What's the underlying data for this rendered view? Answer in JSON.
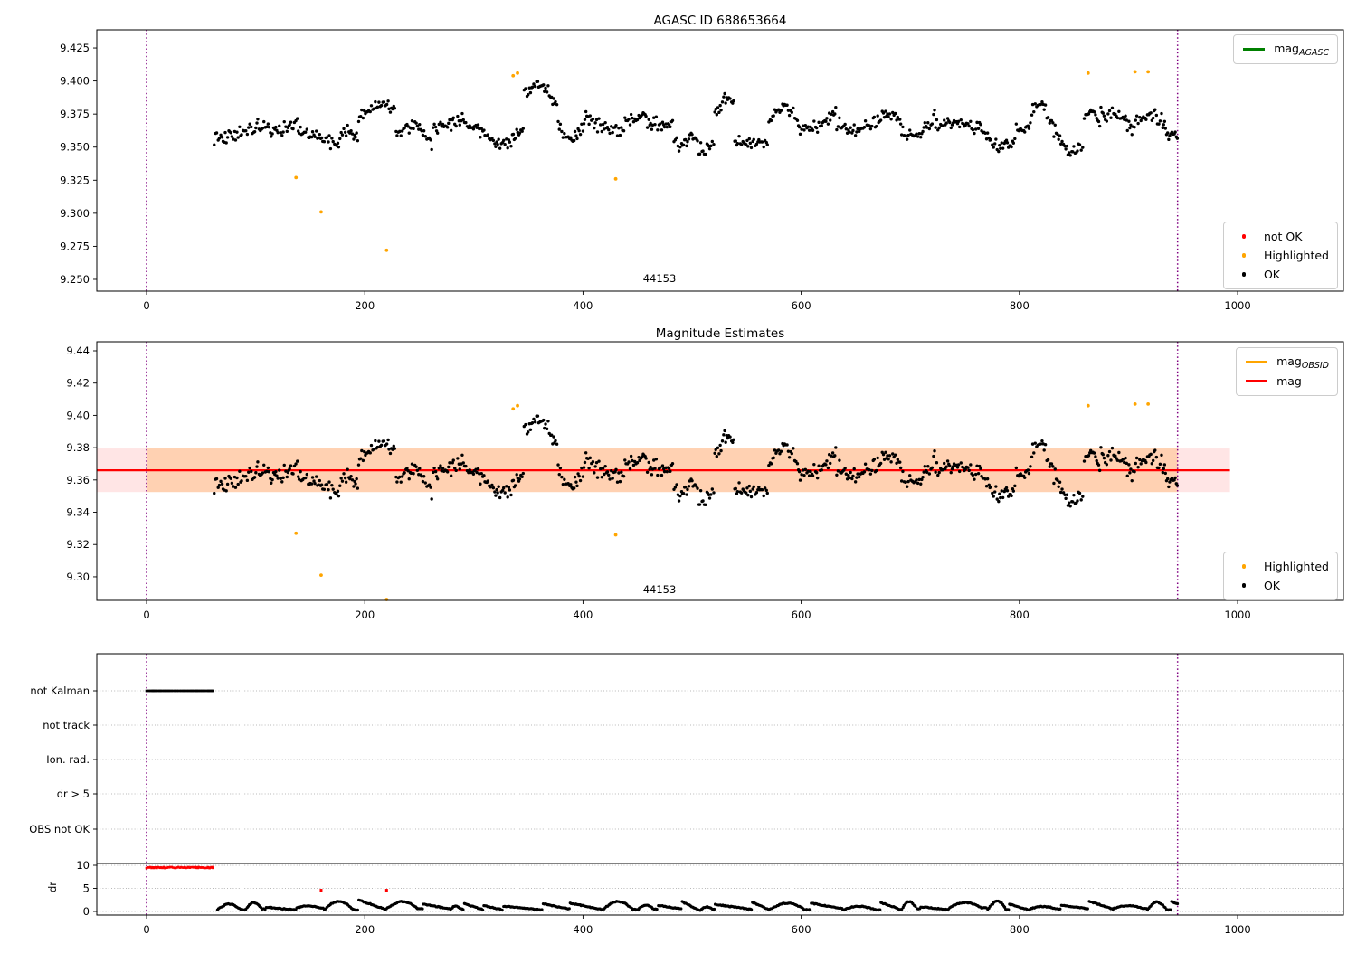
{
  "colors": {
    "ok": "#000000",
    "highlighted": "#ffa500",
    "not_ok": "#ff0000",
    "mag_line": "#ff0000",
    "mag_agasc_line": "#008000",
    "mag_obsid_line": "#ffa500",
    "vline": "#800080",
    "band_wide": "#ff0000",
    "band_obs": "#ff8c00",
    "grid": "#b8b8b8"
  },
  "chart_data": {
    "type": "scatter",
    "panels": [
      {
        "id": "top",
        "title": "AGASC ID 688653664",
        "annotation": {
          "text": "44153",
          "x": 470
        },
        "xlim": [
          -45.6,
          1097
        ],
        "ylim": [
          9.2411,
          9.4387
        ],
        "xticks": [
          0,
          200,
          400,
          600,
          800,
          1000
        ],
        "yticks": [
          "9.250",
          "9.275",
          "9.300",
          "9.325",
          "9.350",
          "9.375",
          "9.400",
          "9.425"
        ],
        "vlines": [
          0,
          945
        ],
        "legend_upper": [
          {
            "label": "mag",
            "sub": "AGASC",
            "marker": "line",
            "color": "#008000"
          }
        ],
        "legend_lower": [
          {
            "label": "not OK",
            "marker": "dot",
            "color": "#ff0000"
          },
          {
            "label": "Highlighted",
            "marker": "dot",
            "color": "#ffa500"
          },
          {
            "label": "OK",
            "marker": "dot",
            "color": "#000000"
          }
        ],
        "highlighted_points": [
          [
            137,
            9.327
          ],
          [
            160,
            9.301
          ],
          [
            220,
            9.272
          ],
          [
            336,
            9.404
          ],
          [
            340,
            9.406
          ],
          [
            430,
            9.326
          ],
          [
            863,
            9.406
          ],
          [
            906,
            9.407
          ],
          [
            918,
            9.407
          ]
        ]
      },
      {
        "id": "middle",
        "title": "Magnitude Estimates",
        "annotation": {
          "text": "44153",
          "x": 470
        },
        "xlim": [
          -45.6,
          1097
        ],
        "ylim": [
          9.2854,
          9.4456
        ],
        "xticks": [
          0,
          200,
          400,
          600,
          800,
          1000
        ],
        "yticks": [
          "9.30",
          "9.32",
          "9.34",
          "9.36",
          "9.38",
          "9.40",
          "9.42",
          "9.44"
        ],
        "vlines": [
          0,
          945
        ],
        "mag_line": {
          "y": 9.366,
          "x_start": -45.6,
          "x_end": 993
        },
        "band_wide": {
          "y0": 9.3525,
          "y1": 9.3795,
          "x_start": -45.6,
          "x_end": 993
        },
        "band_obs": {
          "y0": 9.3525,
          "y1": 9.3795,
          "x_start": 0,
          "x_end": 945
        },
        "legend_upper": [
          {
            "label": "mag",
            "sub": "OBSID",
            "marker": "line",
            "color": "#ffa500"
          },
          {
            "label": "mag",
            "sub": "",
            "marker": "line",
            "color": "#ff0000"
          }
        ],
        "legend_lower": [
          {
            "label": "Highlighted",
            "marker": "dot",
            "color": "#ffa500"
          },
          {
            "label": "OK",
            "marker": "dot",
            "color": "#000000"
          }
        ],
        "highlighted_points": [
          [
            137,
            9.327
          ],
          [
            160,
            9.301
          ],
          [
            220,
            9.272
          ],
          [
            336,
            9.404
          ],
          [
            340,
            9.406
          ],
          [
            430,
            9.326
          ],
          [
            863,
            9.406
          ],
          [
            906,
            9.407
          ],
          [
            918,
            9.407
          ]
        ]
      },
      {
        "id": "flags",
        "categories": [
          "not Kalman",
          "not track",
          "Ion. rad.",
          "dr > 5",
          "OBS not OK"
        ],
        "dr_label": "dr",
        "dr_ticks": [
          "10",
          "5",
          "0"
        ],
        "xticks": [
          0,
          200,
          400,
          600,
          800,
          1000
        ],
        "xlim": [
          -45.6,
          1097
        ],
        "vlines": [
          0,
          945
        ],
        "hline_dr": 10,
        "flag_runs": [
          {
            "category": "not Kalman",
            "x_start": 0,
            "x_end": 62
          }
        ],
        "not_ok_dr_run": {
          "x_start": 0,
          "x_end": 62,
          "dr": 9.5
        },
        "not_ok_dr_points": [
          [
            160,
            4.6
          ],
          [
            220,
            4.6
          ]
        ]
      }
    ],
    "ok_scatter_model": {
      "seed": 12345,
      "x_start": 62,
      "x_end": 945,
      "mean": 9.3635,
      "min": 9.329,
      "max": 9.407
    },
    "dr_trace_model": {
      "seed": 54321,
      "x_start": 65,
      "x_end": 945,
      "min": 0.05,
      "max": 3.0
    }
  }
}
